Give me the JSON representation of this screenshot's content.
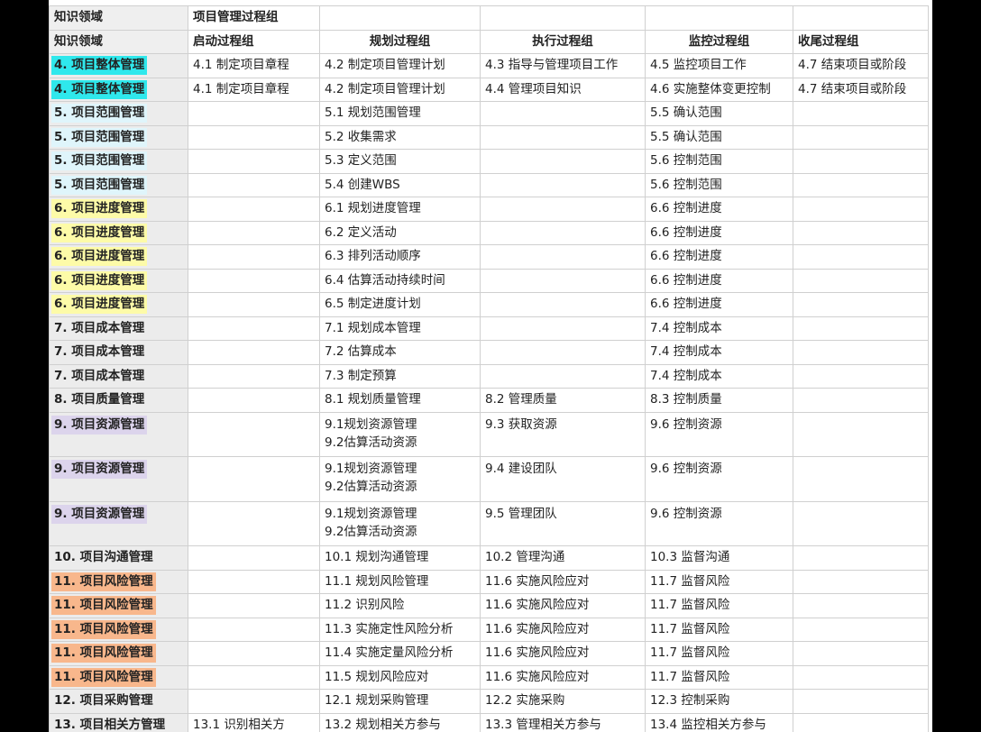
{
  "header_row1": [
    "知识领域",
    "项目管理过程组",
    "",
    "",
    "",
    ""
  ],
  "header_row2": [
    "知识领域",
    "启动过程组",
    "规划过程组",
    "执行过程组",
    "监控过程组",
    "收尾过程组"
  ],
  "colors": {
    "cyan": "#2fe8ec",
    "light_cyan": "#dff5fb",
    "yellow": "#fdfba8",
    "purple": "#dcd4ec",
    "orange": "#f8b78c",
    "header_gray": "#efefef"
  },
  "rows": [
    {
      "area": "4. 项目整体管理",
      "hl": "cyan",
      "initiating": "4.1 制定项目章程",
      "planning": [
        "4.2 制定项目管理计划"
      ],
      "executing": "4.3 指导与管理项目工作",
      "monitoring": "4.5 监控项目工作",
      "closing": "4.7 结束项目或阶段"
    },
    {
      "area": "4. 项目整体管理",
      "hl": "cyan",
      "initiating": "4.1 制定项目章程",
      "planning": [
        "4.2 制定项目管理计划"
      ],
      "executing": "4.4 管理项目知识",
      "monitoring": "4.6 实施整体变更控制",
      "closing": "4.7 结束项目或阶段"
    },
    {
      "area": "5. 项目范围管理",
      "hl": "lcyan",
      "initiating": "",
      "planning": [
        "5.1 规划范围管理"
      ],
      "executing": "",
      "monitoring": "5.5 确认范围",
      "closing": ""
    },
    {
      "area": "5. 项目范围管理",
      "hl": "lcyan",
      "initiating": "",
      "planning": [
        "5.2 收集需求"
      ],
      "executing": "",
      "monitoring": "5.5 确认范围",
      "closing": ""
    },
    {
      "area": "5. 项目范围管理",
      "hl": "lcyan",
      "initiating": "",
      "planning": [
        "5.3 定义范围"
      ],
      "executing": "",
      "monitoring": "5.6 控制范围",
      "closing": ""
    },
    {
      "area": "5. 项目范围管理",
      "hl": "lcyan",
      "initiating": "",
      "planning": [
        "5.4 创建WBS"
      ],
      "executing": "",
      "monitoring": "5.6 控制范围",
      "closing": ""
    },
    {
      "area": "6. 项目进度管理",
      "hl": "yellow",
      "initiating": "",
      "planning": [
        "6.1 规划进度管理"
      ],
      "executing": "",
      "monitoring": "6.6 控制进度",
      "closing": ""
    },
    {
      "area": "6. 项目进度管理",
      "hl": "yellow",
      "initiating": "",
      "planning": [
        "6.2 定义活动"
      ],
      "executing": "",
      "monitoring": "6.6 控制进度",
      "closing": ""
    },
    {
      "area": "6. 项目进度管理",
      "hl": "yellow",
      "initiating": "",
      "planning": [
        "6.3 排列活动顺序"
      ],
      "executing": "",
      "monitoring": "6.6 控制进度",
      "closing": ""
    },
    {
      "area": "6. 项目进度管理",
      "hl": "yellow",
      "initiating": "",
      "planning": [
        "6.4 估算活动持续时间"
      ],
      "executing": "",
      "monitoring": "6.6 控制进度",
      "closing": ""
    },
    {
      "area": "6. 项目进度管理",
      "hl": "yellow",
      "initiating": "",
      "planning": [
        "6.5 制定进度计划"
      ],
      "executing": "",
      "monitoring": "6.6 控制进度",
      "closing": ""
    },
    {
      "area": "7. 项目成本管理",
      "hl": "none",
      "initiating": "",
      "planning": [
        "7.1 规划成本管理"
      ],
      "executing": "",
      "monitoring": "7.4 控制成本",
      "closing": ""
    },
    {
      "area": "7. 项目成本管理",
      "hl": "none",
      "initiating": "",
      "planning": [
        "7.2 估算成本"
      ],
      "executing": "",
      "monitoring": "7.4 控制成本",
      "closing": ""
    },
    {
      "area": "7. 项目成本管理",
      "hl": "none",
      "initiating": "",
      "planning": [
        "7.3 制定预算"
      ],
      "executing": "",
      "monitoring": "7.4 控制成本",
      "closing": ""
    },
    {
      "area": "8. 项目质量管理",
      "hl": "none",
      "initiating": "",
      "planning": [
        "8.1 规划质量管理"
      ],
      "executing": "8.2 管理质量",
      "monitoring": "8.3 控制质量",
      "closing": ""
    },
    {
      "area": "9. 项目资源管理",
      "hl": "purple",
      "initiating": "",
      "planning": [
        "9.1规划资源管理",
        "9.2估算活动资源"
      ],
      "executing": "9.3 获取资源",
      "monitoring": "9.6 控制资源",
      "closing": ""
    },
    {
      "area": "9. 项目资源管理",
      "hl": "purple",
      "initiating": "",
      "planning": [
        "9.1规划资源管理",
        "9.2估算活动资源"
      ],
      "executing": "9.4 建设团队",
      "monitoring": "9.6 控制资源",
      "closing": ""
    },
    {
      "area": "9. 项目资源管理",
      "hl": "purple",
      "initiating": "",
      "planning": [
        "9.1规划资源管理",
        "9.2估算活动资源"
      ],
      "executing": "9.5 管理团队",
      "monitoring": "9.6 控制资源",
      "closing": ""
    },
    {
      "area": "10. 项目沟通管理",
      "hl": "none",
      "initiating": "",
      "planning": [
        "10.1 规划沟通管理"
      ],
      "executing": "10.2 管理沟通",
      "monitoring": "10.3 监督沟通",
      "closing": ""
    },
    {
      "area": "11. 项目风险管理",
      "hl": "orange",
      "initiating": "",
      "planning": [
        "11.1 规划风险管理"
      ],
      "executing": "11.6 实施风险应对",
      "monitoring": "11.7 监督风险",
      "closing": ""
    },
    {
      "area": "11. 项目风险管理",
      "hl": "orange",
      "initiating": "",
      "planning": [
        "11.2 识别风险"
      ],
      "executing": "11.6 实施风险应对",
      "monitoring": "11.7 监督风险",
      "closing": ""
    },
    {
      "area": "11. 项目风险管理",
      "hl": "orange",
      "initiating": "",
      "planning": [
        "11.3 实施定性风险分析"
      ],
      "executing": "11.6 实施风险应对",
      "monitoring": "11.7 监督风险",
      "closing": ""
    },
    {
      "area": "11. 项目风险管理",
      "hl": "orange",
      "initiating": "",
      "planning": [
        "11.4 实施定量风险分析"
      ],
      "executing": "11.6 实施风险应对",
      "monitoring": "11.7 监督风险",
      "closing": ""
    },
    {
      "area": "11. 项目风险管理",
      "hl": "orange",
      "initiating": "",
      "planning": [
        "11.5 规划风险应对"
      ],
      "executing": "11.6 实施风险应对",
      "monitoring": "11.7 监督风险",
      "closing": ""
    },
    {
      "area": "12. 项目采购管理",
      "hl": "none",
      "initiating": "",
      "planning": [
        "12.1 规划采购管理"
      ],
      "executing": "12.2 实施采购",
      "monitoring": "12.3 控制采购",
      "closing": ""
    },
    {
      "area": "13. 项目相关方管理",
      "hl": "none",
      "initiating": "13.1 识别相关方",
      "planning": [
        "13.2 规划相关方参与"
      ],
      "executing": "13.3 管理相关方参与",
      "monitoring": "13.4 监控相关方参与",
      "closing": ""
    }
  ]
}
